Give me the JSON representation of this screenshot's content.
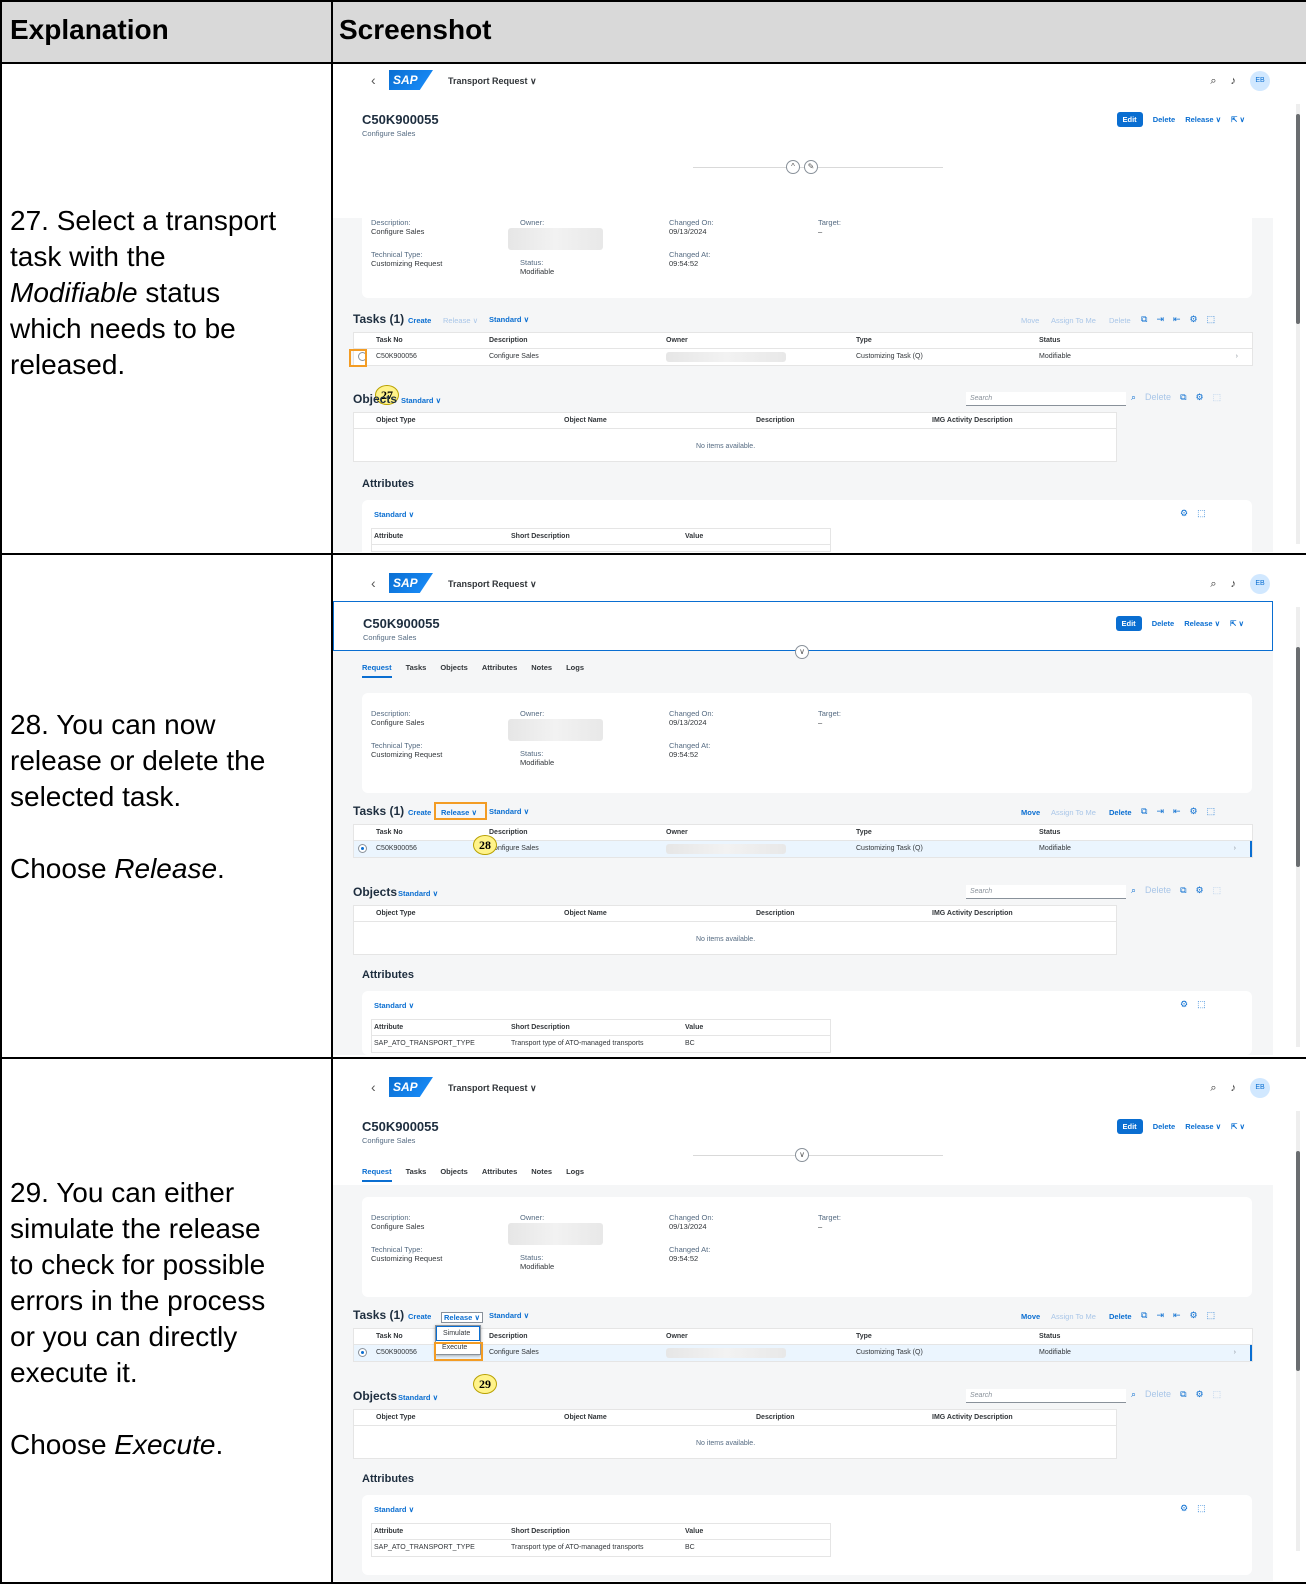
{
  "table": {
    "headers": [
      "Explanation",
      "Screenshot"
    ]
  },
  "rows": [
    {
      "explanation": {
        "lines": [
          "27. Select a transport",
          "task with the"
        ],
        "italic_word": "Modifiable",
        "after_italic": " status",
        "lines2": [
          "which needs to be",
          "released."
        ]
      },
      "badge": "27"
    },
    {
      "explanation": {
        "lines": [
          "28. You can now",
          "release or delete the",
          "selected task."
        ],
        "choose_prefix": "Choose ",
        "choose_word": "Release",
        "choose_suffix": "."
      },
      "badge": "28"
    },
    {
      "explanation": {
        "lines": [
          "29. You can either",
          "simulate the release",
          "to check for possible",
          "errors in the process",
          "or you can directly",
          "execute it."
        ],
        "choose_prefix": "Choose ",
        "choose_word": "Execute",
        "choose_suffix": "."
      },
      "badge": "29"
    }
  ],
  "app": {
    "back": "‹",
    "logo": "SAP",
    "title": "Transport Request ∨",
    "avatar": "EB",
    "search_icon": "search-icon",
    "bell_icon": "bell-icon"
  },
  "header": {
    "request_id": "C50K900055",
    "subtitle": "Configure Sales",
    "edit": "Edit",
    "delete": "Delete",
    "release": "Release ∨",
    "share": "⇱ ∨"
  },
  "tabs": [
    "Request",
    "Tasks",
    "Objects",
    "Attributes",
    "Notes",
    "Logs"
  ],
  "fields": {
    "description_label": "Description:",
    "description_value": "Configure Sales",
    "owner_label": "Owner:",
    "changed_on_label": "Changed On:",
    "changed_on_value": "09/13/2024",
    "target_label": "Target:",
    "target_value": "–",
    "tech_type_label": "Technical Type:",
    "tech_type_value": "Customizing Request",
    "status_label": "Status:",
    "status_value": "Modifiable",
    "changed_at_label": "Changed At:",
    "changed_at_value": "09:54:52"
  },
  "tasks": {
    "title": "Tasks (1)",
    "create": "Create",
    "release": "Release ∨",
    "variant": "Standard ∨",
    "move": "Move",
    "assign": "Assign To Me",
    "delete": "Delete",
    "headers": [
      "Task No",
      "Description",
      "Owner",
      "Type",
      "Status"
    ],
    "row": {
      "task_no": "C50K900056",
      "description": "Configure Sales",
      "type": "Customizing Task (Q)",
      "status": "Modifiable"
    }
  },
  "objects": {
    "title": "Objects",
    "variant": "Standard ∨",
    "search_placeholder": "Search",
    "delete": "Delete",
    "headers": [
      "Object Type",
      "Object Name",
      "Description",
      "IMG Activity Description"
    ],
    "empty": "No items available."
  },
  "attributes": {
    "title": "Attributes",
    "variant": "Standard ∨",
    "headers": [
      "Attribute",
      "Short Description",
      "Value"
    ],
    "row": {
      "attribute": "SAP_ATO_TRANSPORT_TYPE",
      "short_description": "Transport type of ATO-managed transports",
      "value": "BC"
    }
  },
  "release_menu": {
    "simulate": "Simulate",
    "execute": "Execute"
  },
  "colors": {
    "accent": "#0a6ed1",
    "highlight": "#f39c24",
    "badge": "#fff38a"
  }
}
